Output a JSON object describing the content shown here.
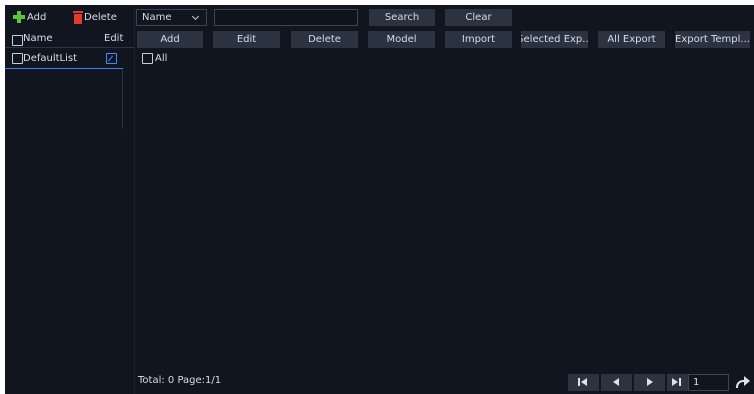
{
  "left_panel": {
    "toolbar": {
      "add_label": "Add",
      "delete_label": "Delete"
    },
    "header": {
      "name_label": "Name",
      "edit_label": "Edit"
    },
    "lists": [
      {
        "name": "DefaultList"
      }
    ]
  },
  "search_bar": {
    "field_select": "Name",
    "search_value": "",
    "search_label": "Search",
    "clear_label": "Clear"
  },
  "toolbar": {
    "add": "Add",
    "edit": "Edit",
    "delete": "Delete",
    "model": "Model",
    "import": "Import",
    "selected_export": "Selected Exp...",
    "all_export": "All Export",
    "export_template": "Export Templ..."
  },
  "table": {
    "select_all_label": "All"
  },
  "footer": {
    "total_text": "Total: 0  Page:1/1",
    "page_input": "1"
  },
  "icons": {
    "add": "plus-icon",
    "delete": "trash-icon",
    "edit_row": "edit-icon",
    "first": "first-page-icon",
    "prev": "prev-page-icon",
    "next": "next-page-icon",
    "last": "last-page-icon",
    "go": "go-arrow-icon"
  },
  "colors": {
    "background": "#10151f",
    "button": "#2b3240",
    "accent_blue": "#3f8cff",
    "add_green": "#5cc63a",
    "delete_red": "#e23b2c"
  }
}
